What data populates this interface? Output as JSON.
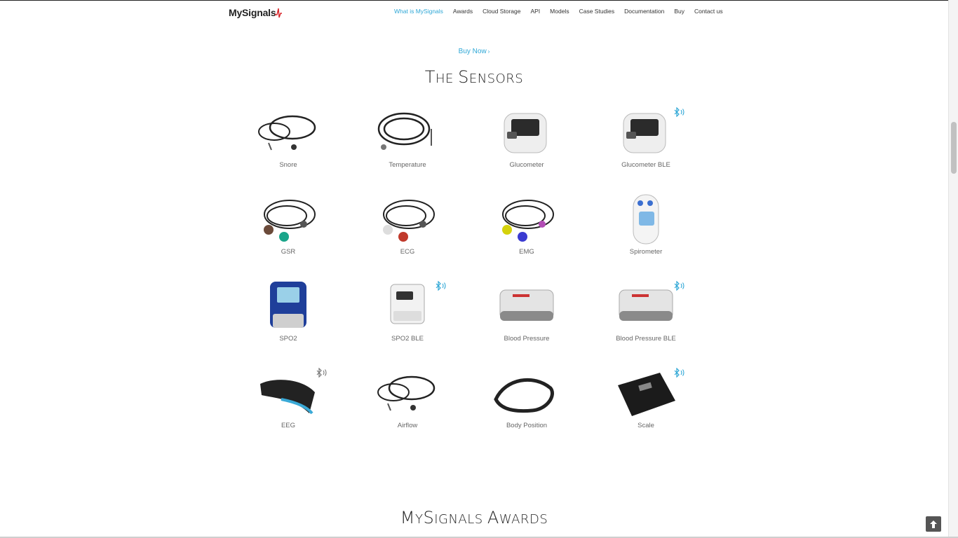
{
  "nav": {
    "logo": "MySignals",
    "items": [
      {
        "label": "What is MySignals",
        "active": true
      },
      {
        "label": "Awards"
      },
      {
        "label": "Cloud Storage"
      },
      {
        "label": "API"
      },
      {
        "label": "Models"
      },
      {
        "label": "Case Studies"
      },
      {
        "label": "Documentation"
      },
      {
        "label": "Buy"
      },
      {
        "label": "Contact us"
      }
    ]
  },
  "buy_now": "Buy Now",
  "sensors_title": {
    "first": "T",
    "rest": "HE ",
    "second": "S",
    "rest2": "ENSORS"
  },
  "sensors": [
    {
      "label": "Snore",
      "icon": "snore-sensor-icon",
      "ble": false
    },
    {
      "label": "Temperature",
      "icon": "temperature-sensor-icon",
      "ble": false
    },
    {
      "label": "Glucometer",
      "icon": "glucometer-icon",
      "ble": false
    },
    {
      "label": "Glucometer BLE",
      "icon": "glucometer-ble-icon",
      "ble": true
    },
    {
      "label": "GSR",
      "icon": "gsr-sensor-icon",
      "ble": false
    },
    {
      "label": "ECG",
      "icon": "ecg-sensor-icon",
      "ble": false
    },
    {
      "label": "EMG",
      "icon": "emg-sensor-icon",
      "ble": false
    },
    {
      "label": "Spirometer",
      "icon": "spirometer-icon",
      "ble": false
    },
    {
      "label": "SPO2",
      "icon": "spo2-sensor-icon",
      "ble": false
    },
    {
      "label": "SPO2 BLE",
      "icon": "spo2-ble-icon",
      "ble": true
    },
    {
      "label": "Blood Pressure",
      "icon": "blood-pressure-icon",
      "ble": false
    },
    {
      "label": "Blood Pressure BLE",
      "icon": "blood-pressure-ble-icon",
      "ble": true
    },
    {
      "label": "EEG",
      "icon": "eeg-headband-icon",
      "ble": true
    },
    {
      "label": "Airflow",
      "icon": "airflow-sensor-icon",
      "ble": false
    },
    {
      "label": "Body Position",
      "icon": "body-position-sensor-icon",
      "ble": false
    },
    {
      "label": "Scale",
      "icon": "scale-icon",
      "ble": true
    }
  ],
  "awards_title": {
    "a": "M",
    "b": "Y",
    "c": "S",
    "d": "IGNALS ",
    "e": "A",
    "f": "WARDS"
  },
  "colors": {
    "accent": "#2ea7d6",
    "text": "#222222",
    "label": "#666666"
  }
}
